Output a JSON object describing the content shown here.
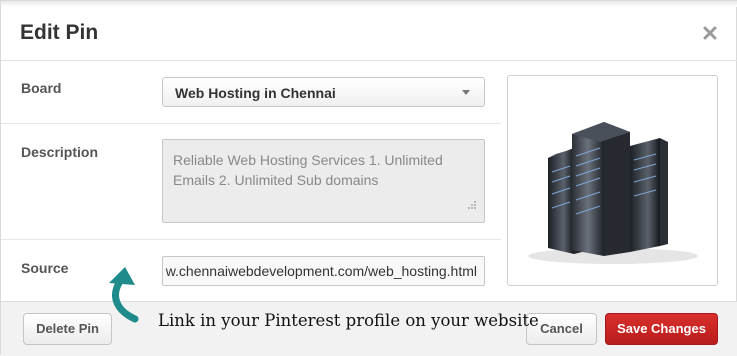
{
  "dialog": {
    "title": "Edit Pin",
    "close_icon": "close-icon"
  },
  "form": {
    "board": {
      "label": "Board",
      "selected": "Web Hosting in Chennai"
    },
    "description": {
      "label": "Description",
      "value": "Reliable Web Hosting Services  1. Unlimited Emails 2. Unlimited Sub domains"
    },
    "source": {
      "label": "Source",
      "value": "w.chennaiwebdevelopment.com/web_hosting.html"
    }
  },
  "preview": {
    "icon": "server-rack-image"
  },
  "footer": {
    "delete_label": "Delete Pin",
    "cancel_label": "Cancel",
    "save_label": "Save Changes"
  },
  "annotation": {
    "text": "Link in your Pinterest profile on your website",
    "arrow_color": "#1f8b8b"
  },
  "colors": {
    "save_button": "#c62222",
    "footer_bg": "#f2f2f2"
  }
}
